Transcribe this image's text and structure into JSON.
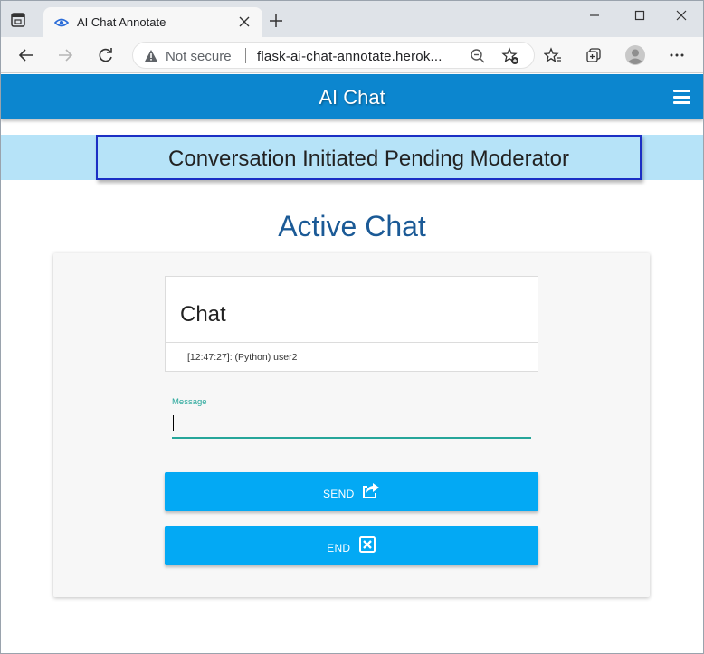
{
  "browser": {
    "tab_title": "AI Chat Annotate",
    "not_secure_label": "Not secure",
    "url": "flask-ai-chat-annotate.herok..."
  },
  "header": {
    "title": "AI Chat"
  },
  "status": {
    "text": "Conversation Initiated Pending Moderator"
  },
  "main": {
    "heading": "Active Chat",
    "chat": {
      "title": "Chat",
      "messages": [
        "[12:47:27]: (Python) user2"
      ]
    },
    "message_field": {
      "label": "Message",
      "value": ""
    },
    "send_button": {
      "label": "SEND",
      "icon": "share-square-icon"
    },
    "end_button": {
      "label": "END",
      "icon": "close-box-icon"
    }
  },
  "colors": {
    "header": "#0c86cf",
    "status_strip": "#b6e3f8",
    "status_border": "#1b2fc4",
    "heading": "#1b5a96",
    "button": "#03a9f4",
    "input_accent": "#26a69a"
  }
}
